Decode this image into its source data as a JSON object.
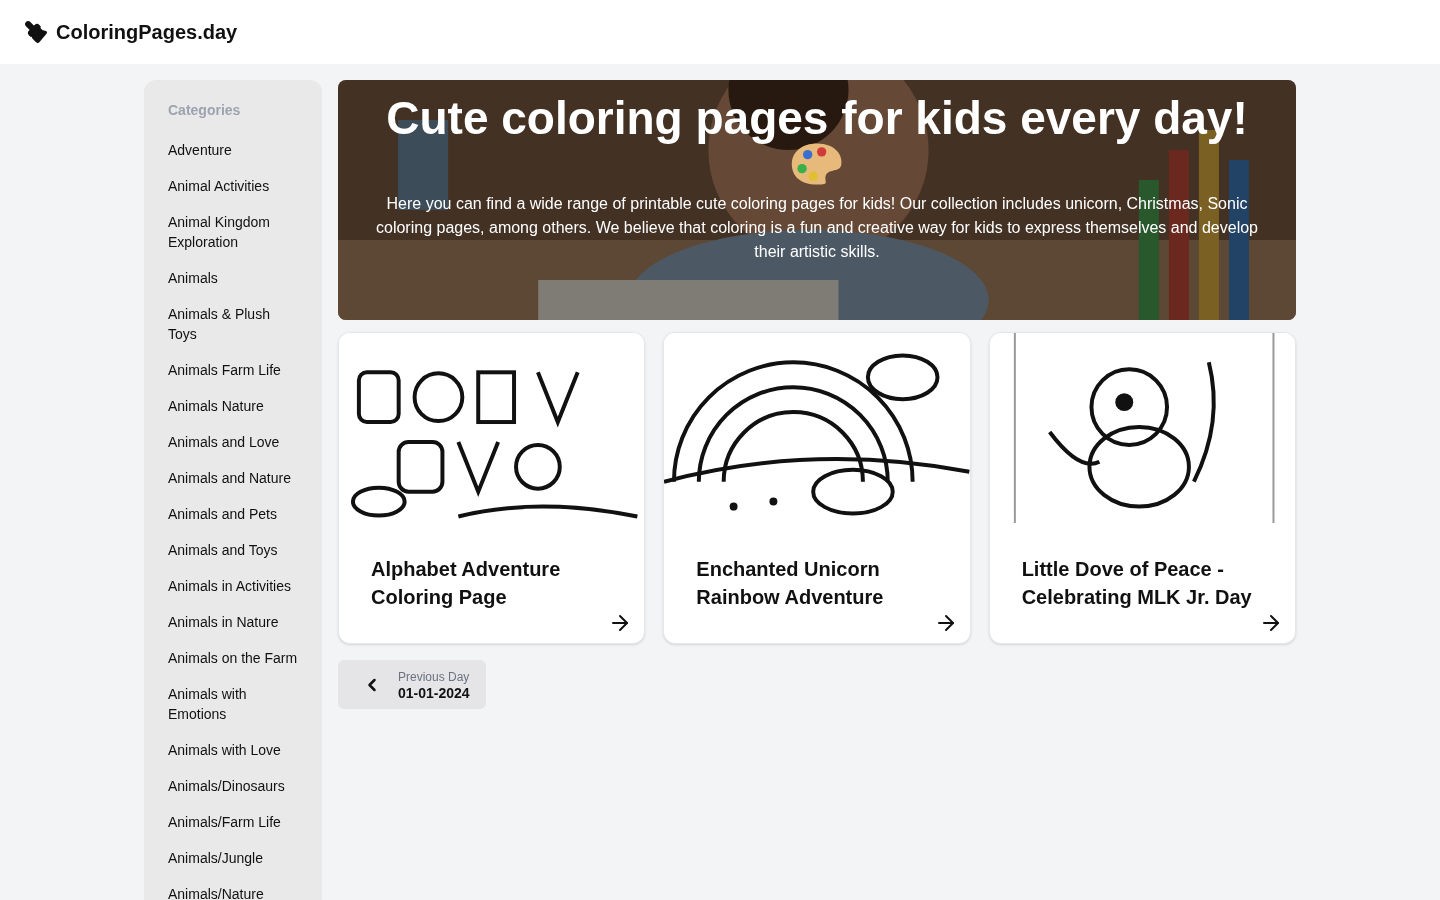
{
  "header": {
    "site_name": "ColoringPages.day"
  },
  "sidebar": {
    "heading": "Categories",
    "items": [
      "Adventure",
      "Animal Activities",
      "Animal Kingdom Exploration",
      "Animals",
      "Animals & Plush Toys",
      "Animals Farm Life",
      "Animals Nature",
      "Animals and Love",
      "Animals and Nature",
      "Animals and Pets",
      "Animals and Toys",
      "Animals in Activities",
      "Animals in Nature",
      "Animals on the Farm",
      "Animals with Emotions",
      "Animals with Love",
      "Animals/Dinosaurs",
      "Animals/Farm Life",
      "Animals/Jungle",
      "Animals/Nature"
    ]
  },
  "hero": {
    "title": "Cute coloring pages for kids every day!",
    "text": "Here you can find a wide range of printable cute coloring pages for kids! Our collection includes unicorn, Christmas, Sonic coloring pages, among others. We believe that coloring is a fun and creative way for kids to express themselves and develop their artistic skills."
  },
  "cards": [
    {
      "title": "Alphabet Adventure Coloring Page"
    },
    {
      "title": "Enchanted Unicorn Rainbow Adventure"
    },
    {
      "title": "Little Dove of Peace - Celebrating MLK Jr. Day"
    }
  ],
  "pager": {
    "label": "Previous Day",
    "date": "01-01-2024"
  }
}
